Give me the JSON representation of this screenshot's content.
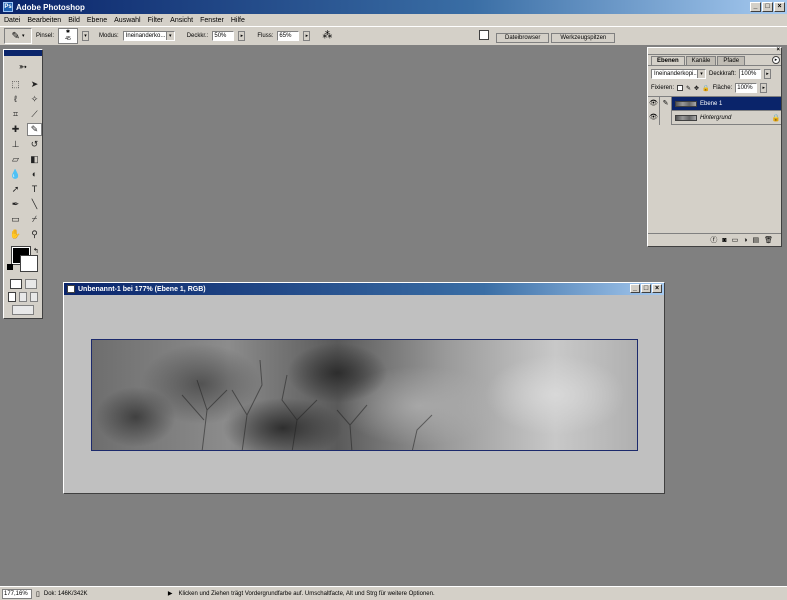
{
  "app": {
    "title": "Adobe Photoshop"
  },
  "menu": [
    "Datei",
    "Bearbeiten",
    "Bild",
    "Ebene",
    "Auswahl",
    "Filter",
    "Ansicht",
    "Fenster",
    "Hilfe"
  ],
  "options": {
    "brush_label": "Pinsel:",
    "brush_size": "45",
    "mode_label": "Modus:",
    "mode_value": "Ineinanderko...",
    "opacity_label": "Deckkr.:",
    "opacity_value": "50%",
    "flow_label": "Fluss:",
    "flow_value": "65%"
  },
  "palette_well": {
    "tabs": [
      "Dateibrowser",
      "Werkzeugspitzen"
    ]
  },
  "layers": {
    "tabs": [
      "Ebenen",
      "Kanäle",
      "Pfade"
    ],
    "blend_mode": "Ineinanderkopi...",
    "opacity_label": "Deckkraft:",
    "opacity_value": "100%",
    "lock_label": "Fixieren:",
    "fill_label": "Fläche:",
    "fill_value": "100%",
    "items": [
      {
        "name": "Ebene 1",
        "selected": true
      },
      {
        "name": "Hintergrund",
        "selected": false
      }
    ]
  },
  "document": {
    "title": "Unbenannt-1 bei 177% (Ebene 1, RGB)"
  },
  "status": {
    "zoom": "177,16%",
    "doc_size": "Dok: 146K/342K",
    "hint": "Klicken und Ziehen trägt Vordergrundfarbe auf. Umschaltfacte, Alt und Strg für weitere Optionen."
  }
}
